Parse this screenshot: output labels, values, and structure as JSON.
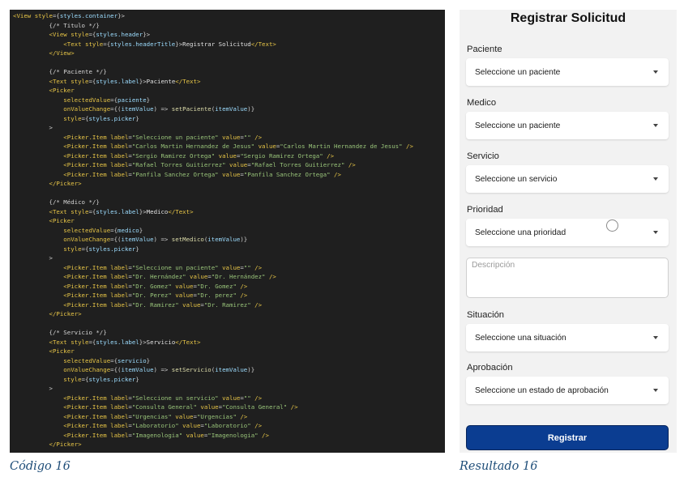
{
  "code_panel": {
    "lines": [
      [
        {
          "c": "tag",
          "t": "<View "
        },
        {
          "c": "attr",
          "t": "style"
        },
        {
          "c": "punc",
          "t": "={"
        },
        {
          "c": "obj",
          "t": "styles.container"
        },
        {
          "c": "punc",
          "t": "}>"
        }
      ],
      [
        {
          "c": "cmt",
          "t": "          {/* Titulo */}"
        }
      ],
      [
        {
          "c": "tag",
          "t": "          <View "
        },
        {
          "c": "attr",
          "t": "style"
        },
        {
          "c": "punc",
          "t": "={"
        },
        {
          "c": "obj",
          "t": "styles.header"
        },
        {
          "c": "punc",
          "t": "}>"
        }
      ],
      [
        {
          "c": "tag",
          "t": "              <Text "
        },
        {
          "c": "attr",
          "t": "style"
        },
        {
          "c": "punc",
          "t": "={"
        },
        {
          "c": "obj",
          "t": "styles.headerTitle"
        },
        {
          "c": "punc",
          "t": "}>"
        },
        {
          "c": "text",
          "t": "Registrar Solicitud"
        },
        {
          "c": "tag",
          "t": "</Text>"
        }
      ],
      [
        {
          "c": "tag",
          "t": "          </View>"
        }
      ],
      [
        {
          "c": "text",
          "t": ""
        }
      ],
      [
        {
          "c": "cmt",
          "t": "          {/* Paciente */}"
        }
      ],
      [
        {
          "c": "tag",
          "t": "          <Text "
        },
        {
          "c": "attr",
          "t": "style"
        },
        {
          "c": "punc",
          "t": "={"
        },
        {
          "c": "obj",
          "t": "styles.label"
        },
        {
          "c": "punc",
          "t": "}>"
        },
        {
          "c": "text",
          "t": "Paciente"
        },
        {
          "c": "tag",
          "t": "</Text>"
        }
      ],
      [
        {
          "c": "tag",
          "t": "          <Picker"
        }
      ],
      [
        {
          "c": "attr",
          "t": "              selectedValue"
        },
        {
          "c": "punc",
          "t": "={"
        },
        {
          "c": "obj",
          "t": "paciente"
        },
        {
          "c": "punc",
          "t": "}"
        }
      ],
      [
        {
          "c": "attr",
          "t": "              onValueChange"
        },
        {
          "c": "punc",
          "t": "={("
        },
        {
          "c": "obj",
          "t": "itemValue"
        },
        {
          "c": "punc",
          "t": ") => "
        },
        {
          "c": "fn",
          "t": "setPaciente"
        },
        {
          "c": "punc",
          "t": "("
        },
        {
          "c": "obj",
          "t": "itemValue"
        },
        {
          "c": "punc",
          "t": ")}"
        }
      ],
      [
        {
          "c": "attr",
          "t": "              style"
        },
        {
          "c": "punc",
          "t": "={"
        },
        {
          "c": "obj",
          "t": "styles.picker"
        },
        {
          "c": "punc",
          "t": "}"
        }
      ],
      [
        {
          "c": "punc",
          "t": "          >"
        }
      ],
      [
        {
          "c": "tag",
          "t": "              <Picker.Item "
        },
        {
          "c": "attr",
          "t": "label"
        },
        {
          "c": "punc",
          "t": "="
        },
        {
          "c": "str",
          "t": "\"Seleccione un paciente\""
        },
        {
          "c": "attr",
          "t": " value"
        },
        {
          "c": "punc",
          "t": "="
        },
        {
          "c": "str",
          "t": "\"\""
        },
        {
          "c": "tag",
          "t": " />"
        }
      ],
      [
        {
          "c": "tag",
          "t": "              <Picker.Item "
        },
        {
          "c": "attr",
          "t": "label"
        },
        {
          "c": "punc",
          "t": "="
        },
        {
          "c": "str",
          "t": "\"Carlos Martin Hernandez de Jesus\""
        },
        {
          "c": "attr",
          "t": " value"
        },
        {
          "c": "punc",
          "t": "="
        },
        {
          "c": "str",
          "t": "\"Carlos Martin Hernandez de Jesus\""
        },
        {
          "c": "tag",
          "t": " />"
        }
      ],
      [
        {
          "c": "tag",
          "t": "              <Picker.Item "
        },
        {
          "c": "attr",
          "t": "label"
        },
        {
          "c": "punc",
          "t": "="
        },
        {
          "c": "str",
          "t": "\"Sergio Ramirez Ortega\""
        },
        {
          "c": "attr",
          "t": " value"
        },
        {
          "c": "punc",
          "t": "="
        },
        {
          "c": "str",
          "t": "\"Sergio Ramirez Ortega\""
        },
        {
          "c": "tag",
          "t": " />"
        }
      ],
      [
        {
          "c": "tag",
          "t": "              <Picker.Item "
        },
        {
          "c": "attr",
          "t": "label"
        },
        {
          "c": "punc",
          "t": "="
        },
        {
          "c": "str",
          "t": "\"Rafael Torres Guitierrez\""
        },
        {
          "c": "attr",
          "t": " value"
        },
        {
          "c": "punc",
          "t": "="
        },
        {
          "c": "str",
          "t": "\"Rafael Torres Guitierrez\""
        },
        {
          "c": "tag",
          "t": " />"
        }
      ],
      [
        {
          "c": "tag",
          "t": "              <Picker.Item "
        },
        {
          "c": "attr",
          "t": "label"
        },
        {
          "c": "punc",
          "t": "="
        },
        {
          "c": "str",
          "t": "\"Panfila Sanchez Ortega\""
        },
        {
          "c": "attr",
          "t": " value"
        },
        {
          "c": "punc",
          "t": "="
        },
        {
          "c": "str",
          "t": "\"Panfila Sanchez Ortega\""
        },
        {
          "c": "tag",
          "t": " />"
        }
      ],
      [
        {
          "c": "tag",
          "t": "          </Picker>"
        }
      ],
      [
        {
          "c": "text",
          "t": ""
        }
      ],
      [
        {
          "c": "cmt",
          "t": "          {/* Médico */}"
        }
      ],
      [
        {
          "c": "tag",
          "t": "          <Text "
        },
        {
          "c": "attr",
          "t": "style"
        },
        {
          "c": "punc",
          "t": "={"
        },
        {
          "c": "obj",
          "t": "styles.label"
        },
        {
          "c": "punc",
          "t": "}>"
        },
        {
          "c": "text",
          "t": "Medico"
        },
        {
          "c": "tag",
          "t": "</Text>"
        }
      ],
      [
        {
          "c": "tag",
          "t": "          <Picker"
        }
      ],
      [
        {
          "c": "attr",
          "t": "              selectedValue"
        },
        {
          "c": "punc",
          "t": "={"
        },
        {
          "c": "obj",
          "t": "medico"
        },
        {
          "c": "punc",
          "t": "}"
        }
      ],
      [
        {
          "c": "attr",
          "t": "              onValueChange"
        },
        {
          "c": "punc",
          "t": "={("
        },
        {
          "c": "obj",
          "t": "itemValue"
        },
        {
          "c": "punc",
          "t": ") => "
        },
        {
          "c": "fn",
          "t": "setMedico"
        },
        {
          "c": "punc",
          "t": "("
        },
        {
          "c": "obj",
          "t": "itemValue"
        },
        {
          "c": "punc",
          "t": ")}"
        }
      ],
      [
        {
          "c": "attr",
          "t": "              style"
        },
        {
          "c": "punc",
          "t": "={"
        },
        {
          "c": "obj",
          "t": "styles.picker"
        },
        {
          "c": "punc",
          "t": "}"
        }
      ],
      [
        {
          "c": "punc",
          "t": "          >"
        }
      ],
      [
        {
          "c": "tag",
          "t": "              <Picker.Item "
        },
        {
          "c": "attr",
          "t": "label"
        },
        {
          "c": "punc",
          "t": "="
        },
        {
          "c": "str",
          "t": "\"Seleccione un paciente\""
        },
        {
          "c": "attr",
          "t": " value"
        },
        {
          "c": "punc",
          "t": "="
        },
        {
          "c": "str",
          "t": "\"\""
        },
        {
          "c": "tag",
          "t": " />"
        }
      ],
      [
        {
          "c": "tag",
          "t": "              <Picker.Item "
        },
        {
          "c": "attr",
          "t": "label"
        },
        {
          "c": "punc",
          "t": "="
        },
        {
          "c": "str",
          "t": "\"Dr. Hernández\""
        },
        {
          "c": "attr",
          "t": " value"
        },
        {
          "c": "punc",
          "t": "="
        },
        {
          "c": "str",
          "t": "\"Dr. Hernández\""
        },
        {
          "c": "tag",
          "t": " />"
        }
      ],
      [
        {
          "c": "tag",
          "t": "              <Picker.Item "
        },
        {
          "c": "attr",
          "t": "label"
        },
        {
          "c": "punc",
          "t": "="
        },
        {
          "c": "str",
          "t": "\"Dr. Gomez\""
        },
        {
          "c": "attr",
          "t": " value"
        },
        {
          "c": "punc",
          "t": "="
        },
        {
          "c": "str",
          "t": "\"Dr. Gomez\""
        },
        {
          "c": "tag",
          "t": " />"
        }
      ],
      [
        {
          "c": "tag",
          "t": "              <Picker.Item "
        },
        {
          "c": "attr",
          "t": "label"
        },
        {
          "c": "punc",
          "t": "="
        },
        {
          "c": "str",
          "t": "\"Dr. Perez\""
        },
        {
          "c": "attr",
          "t": " value"
        },
        {
          "c": "punc",
          "t": "="
        },
        {
          "c": "str",
          "t": "\"Dr. perez\""
        },
        {
          "c": "tag",
          "t": " />"
        }
      ],
      [
        {
          "c": "tag",
          "t": "              <Picker.Item "
        },
        {
          "c": "attr",
          "t": "label"
        },
        {
          "c": "punc",
          "t": "="
        },
        {
          "c": "str",
          "t": "\"Dr. Ramirez\""
        },
        {
          "c": "attr",
          "t": " value"
        },
        {
          "c": "punc",
          "t": "="
        },
        {
          "c": "str",
          "t": "\"Dr. Ramirez\""
        },
        {
          "c": "tag",
          "t": " />"
        }
      ],
      [
        {
          "c": "tag",
          "t": "          </Picker>"
        }
      ],
      [
        {
          "c": "text",
          "t": ""
        }
      ],
      [
        {
          "c": "cmt",
          "t": "          {/* Servicio */}"
        }
      ],
      [
        {
          "c": "tag",
          "t": "          <Text "
        },
        {
          "c": "attr",
          "t": "style"
        },
        {
          "c": "punc",
          "t": "={"
        },
        {
          "c": "obj",
          "t": "styles.label"
        },
        {
          "c": "punc",
          "t": "}>"
        },
        {
          "c": "text",
          "t": "Servicio"
        },
        {
          "c": "tag",
          "t": "</Text>"
        }
      ],
      [
        {
          "c": "tag",
          "t": "          <Picker"
        }
      ],
      [
        {
          "c": "attr",
          "t": "              selectedValue"
        },
        {
          "c": "punc",
          "t": "={"
        },
        {
          "c": "obj",
          "t": "servicio"
        },
        {
          "c": "punc",
          "t": "}"
        }
      ],
      [
        {
          "c": "attr",
          "t": "              onValueChange"
        },
        {
          "c": "punc",
          "t": "={("
        },
        {
          "c": "obj",
          "t": "itemValue"
        },
        {
          "c": "punc",
          "t": ") => "
        },
        {
          "c": "fn",
          "t": "setServicio"
        },
        {
          "c": "punc",
          "t": "("
        },
        {
          "c": "obj",
          "t": "itemValue"
        },
        {
          "c": "punc",
          "t": ")}"
        }
      ],
      [
        {
          "c": "attr",
          "t": "              style"
        },
        {
          "c": "punc",
          "t": "={"
        },
        {
          "c": "obj",
          "t": "styles.picker"
        },
        {
          "c": "punc",
          "t": "}"
        }
      ],
      [
        {
          "c": "punc",
          "t": "          >"
        }
      ],
      [
        {
          "c": "tag",
          "t": "              <Picker.Item "
        },
        {
          "c": "attr",
          "t": "label"
        },
        {
          "c": "punc",
          "t": "="
        },
        {
          "c": "str",
          "t": "\"Seleccione un servicio\""
        },
        {
          "c": "attr",
          "t": " value"
        },
        {
          "c": "punc",
          "t": "="
        },
        {
          "c": "str",
          "t": "\"\""
        },
        {
          "c": "tag",
          "t": " />"
        }
      ],
      [
        {
          "c": "tag",
          "t": "              <Picker.Item "
        },
        {
          "c": "attr",
          "t": "label"
        },
        {
          "c": "punc",
          "t": "="
        },
        {
          "c": "str",
          "t": "\"Consulta General\""
        },
        {
          "c": "attr",
          "t": " value"
        },
        {
          "c": "punc",
          "t": "="
        },
        {
          "c": "str",
          "t": "\"Consulta General\""
        },
        {
          "c": "tag",
          "t": " />"
        }
      ],
      [
        {
          "c": "tag",
          "t": "              <Picker.Item "
        },
        {
          "c": "attr",
          "t": "label"
        },
        {
          "c": "punc",
          "t": "="
        },
        {
          "c": "str",
          "t": "\"Urgencias\""
        },
        {
          "c": "attr",
          "t": " value"
        },
        {
          "c": "punc",
          "t": "="
        },
        {
          "c": "str",
          "t": "\"Urgencias\""
        },
        {
          "c": "tag",
          "t": " />"
        }
      ],
      [
        {
          "c": "tag",
          "t": "              <Picker.Item "
        },
        {
          "c": "attr",
          "t": "label"
        },
        {
          "c": "punc",
          "t": "="
        },
        {
          "c": "str",
          "t": "\"Laboratorio\""
        },
        {
          "c": "attr",
          "t": " value"
        },
        {
          "c": "punc",
          "t": "="
        },
        {
          "c": "str",
          "t": "\"Laboratorio\""
        },
        {
          "c": "tag",
          "t": " />"
        }
      ],
      [
        {
          "c": "tag",
          "t": "              <Picker.Item "
        },
        {
          "c": "attr",
          "t": "label"
        },
        {
          "c": "punc",
          "t": "="
        },
        {
          "c": "str",
          "t": "\"Imagenologia\""
        },
        {
          "c": "attr",
          "t": " value"
        },
        {
          "c": "punc",
          "t": "="
        },
        {
          "c": "str",
          "t": "\"Imagenologia\""
        },
        {
          "c": "tag",
          "t": " />"
        }
      ],
      [
        {
          "c": "tag",
          "t": "          </Picker>"
        }
      ]
    ]
  },
  "app": {
    "title": "Registrar Solicitud",
    "fields": [
      {
        "label": "Paciente",
        "value": "Seleccione un paciente"
      },
      {
        "label": "Medico",
        "value": "Seleccione un paciente"
      },
      {
        "label": "Servicio",
        "value": "Seleccione un servicio"
      },
      {
        "label": "Prioridad",
        "value": "Seleccione una prioridad"
      }
    ],
    "description_placeholder": "Descripción",
    "fields_after": [
      {
        "label": "Situación",
        "value": "Seleccione una situación"
      },
      {
        "label": "Aprobación",
        "value": "Seleccione un estado de aprobación"
      }
    ],
    "submit_label": "Registrar"
  },
  "captions": {
    "left": "Código 16",
    "right": "Resultado 16"
  },
  "colors": {
    "code_background": "#1f1f1f",
    "app_background": "#f2f2f2",
    "primary_button": "#0b3d91",
    "caption": "#1f4e79"
  }
}
